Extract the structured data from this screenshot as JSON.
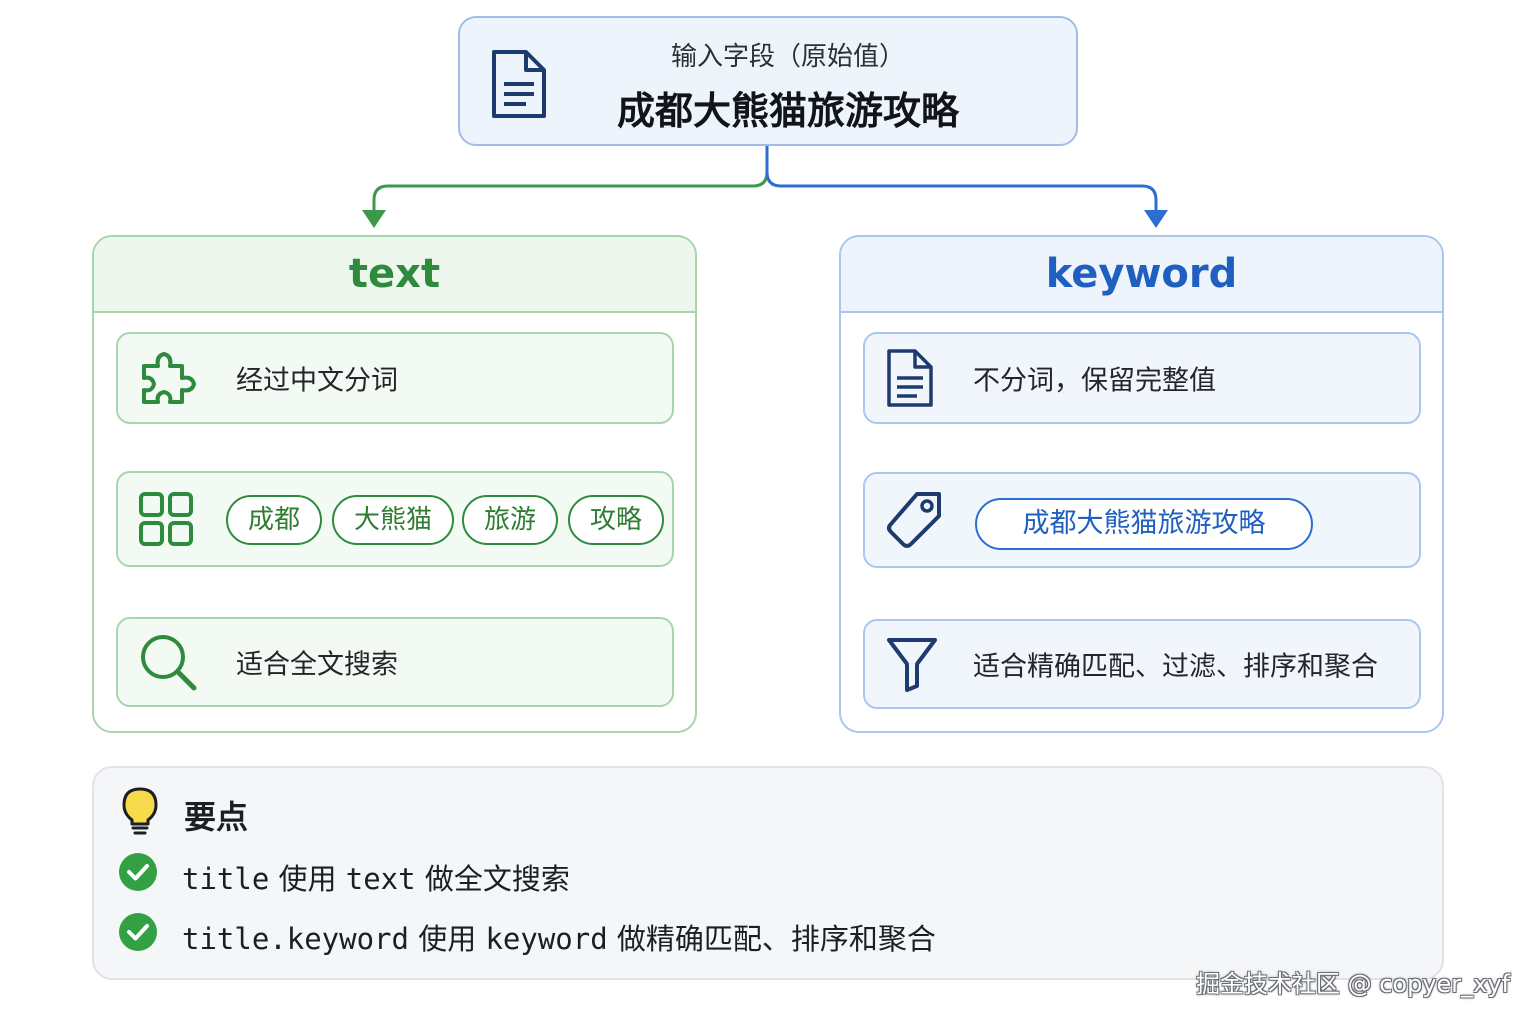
{
  "input": {
    "label": "输入字段（原始值）",
    "value": "成都大熊猫旅游攻略"
  },
  "text_panel": {
    "title": "text",
    "step1": "经过中文分词",
    "tokens": [
      "成都",
      "大熊猫",
      "旅游",
      "攻略"
    ],
    "step3": "适合全文搜索"
  },
  "keyword_panel": {
    "title": "keyword",
    "step1": "不分词，保留完整值",
    "token": "成都大熊猫旅游攻略",
    "step3": "适合精确匹配、过滤、排序和聚合"
  },
  "points": {
    "title": "要点",
    "items": [
      {
        "field": "title",
        "verb": "使用",
        "type": "text",
        "purpose": "做全文搜索"
      },
      {
        "field": "title.keyword",
        "verb": "使用",
        "type": "keyword",
        "purpose": "做精确匹配、排序和聚合"
      }
    ]
  },
  "watermark": "掘金技术社区 @ copyer_xyf",
  "colors": {
    "green": "#2e8b3e",
    "blue": "#2a6fd1",
    "navy": "#1d3b6e"
  }
}
